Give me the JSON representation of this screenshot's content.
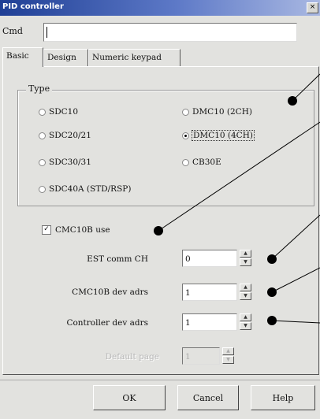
{
  "window": {
    "title": "PID controller",
    "close_label": "×"
  },
  "command": {
    "label": "Cmd",
    "value": ""
  },
  "tabs": [
    {
      "label": "Basic",
      "active": true
    },
    {
      "label": "Design",
      "active": false
    },
    {
      "label": "Numeric keypad",
      "active": false
    }
  ],
  "type_group": {
    "title": "Type",
    "options": [
      {
        "label": "SDC10",
        "selected": false
      },
      {
        "label": "SDC20/21",
        "selected": false
      },
      {
        "label": "SDC30/31",
        "selected": false
      },
      {
        "label": "SDC40A (STD/RSP)",
        "selected": false
      },
      {
        "label": "DMC10 (2CH)",
        "selected": false
      },
      {
        "label": "DMC10 (4CH)",
        "selected": true
      },
      {
        "label": "CB30E",
        "selected": false
      }
    ]
  },
  "cmc_use": {
    "label": "CMC10B use",
    "checked": true,
    "mark": "✓"
  },
  "fields": [
    {
      "label": "EST comm CH",
      "value": "0",
      "enabled": true
    },
    {
      "label": "CMC10B dev adrs",
      "value": "1",
      "enabled": true
    },
    {
      "label": "Controller dev adrs",
      "value": "1",
      "enabled": true
    },
    {
      "label": "Default page",
      "value": "1",
      "enabled": false
    }
  ],
  "spin_glyphs": {
    "up": "▲",
    "down": "▼"
  },
  "buttons": {
    "ok": "OK",
    "cancel": "Cancel",
    "help": "Help"
  },
  "colors": {
    "title_start": "#1f3f95",
    "title_end": "#a9b8e2",
    "window_bg": "#e2e2df"
  }
}
